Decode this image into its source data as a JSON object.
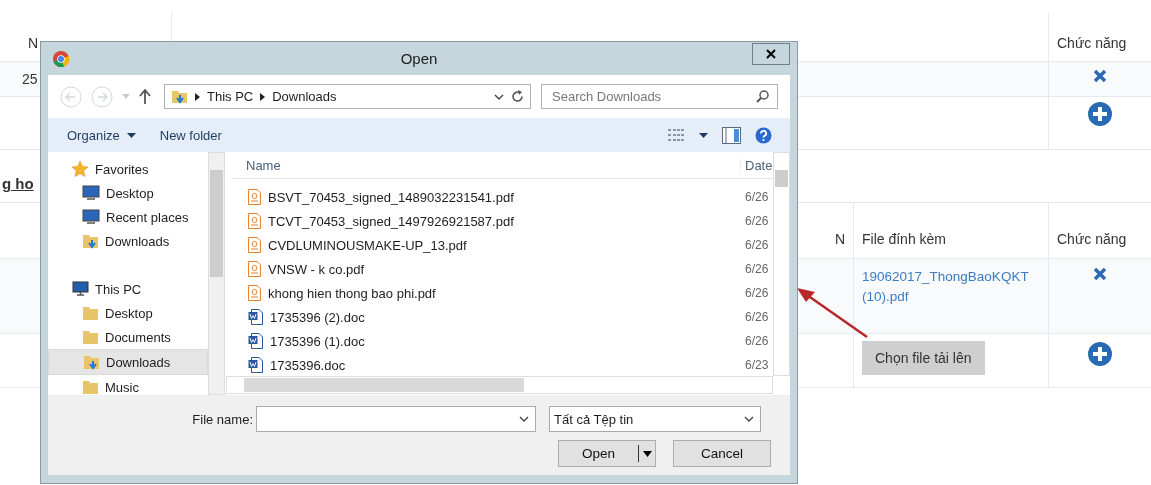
{
  "page": {
    "table_top": {
      "header": {
        "column_1": "N",
        "column_3": "Chức năng"
      },
      "rows": [
        {
          "column_1": "25",
          "action": {
            "kind": "delete"
          }
        },
        {
          "action": {
            "kind": "add"
          }
        }
      ]
    },
    "section_heading": "g ho",
    "table_bottom": {
      "header": {
        "column_1": "N",
        "attachment": "File đính kèm",
        "actions": "Chức năng"
      },
      "rows": [
        {
          "attachment_link": "19062017_ThongBaoKQKT (10).pdf",
          "action": {
            "kind": "delete"
          }
        },
        {
          "upload_button": "Chọn file tải lên",
          "action": {
            "kind": "add"
          }
        }
      ]
    }
  },
  "dialog": {
    "title": "Open",
    "breadcrumb": [
      "This PC",
      "Downloads"
    ],
    "search": {
      "placeholder": "Search Downloads"
    },
    "toolbar": {
      "organize": "Organize",
      "new_folder": "New folder"
    },
    "nav_pane": [
      {
        "label": "Favorites",
        "kind": "favorites",
        "selected": false,
        "children": [
          {
            "label": "Desktop",
            "kind": "desktop",
            "selected": false
          },
          {
            "label": "Recent places",
            "kind": "recent",
            "selected": false
          },
          {
            "label": "Downloads",
            "kind": "downloads",
            "selected": false
          }
        ]
      },
      {
        "label": "This PC",
        "kind": "pc",
        "selected": false,
        "children": [
          {
            "label": "Desktop",
            "kind": "folder-desktop",
            "selected": false
          },
          {
            "label": "Documents",
            "kind": "documents",
            "selected": false
          },
          {
            "label": "Downloads",
            "kind": "downloads",
            "selected": true
          },
          {
            "label": "Music",
            "kind": "music",
            "selected": false
          }
        ]
      }
    ],
    "columns": [
      "Name",
      "Date"
    ],
    "files": [
      {
        "name": "BSVT_70453_signed_1489032231541.pdf",
        "kind": "pdf",
        "date": "6/26"
      },
      {
        "name": "TCVT_70453_signed_1497926921587.pdf",
        "kind": "pdf",
        "date": "6/26"
      },
      {
        "name": "CVDLUMINOUSMAKE-UP_13.pdf",
        "kind": "pdf",
        "date": "6/26"
      },
      {
        "name": "VNSW - k co.pdf",
        "kind": "pdf",
        "date": "6/26"
      },
      {
        "name": "khong hien thong bao phi.pdf",
        "kind": "pdf",
        "date": "6/26"
      },
      {
        "name": "1735396 (2).doc",
        "kind": "doc",
        "date": "6/26"
      },
      {
        "name": "1735396 (1).doc",
        "kind": "doc",
        "date": "6/26"
      },
      {
        "name": "1735396.doc",
        "kind": "doc",
        "date": "6/23"
      }
    ],
    "file_name_label": "File name:",
    "filter": "Tất cả Tệp tin",
    "open_button": "Open",
    "cancel_button": "Cancel"
  }
}
